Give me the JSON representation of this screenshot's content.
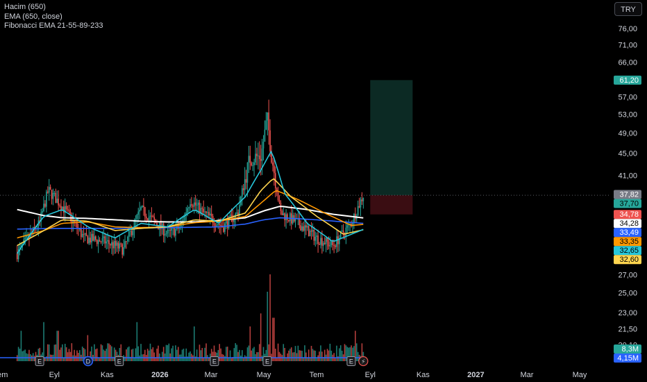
{
  "legend": {
    "volume_title": "Hacim (650)",
    "ema_title": "EMA (650, close)",
    "fib_title": "Fibonacci EMA 21-55-89-233"
  },
  "currency_button": "TRY",
  "colors": {
    "background": "#000000",
    "up": "#26a69a",
    "down": "#ef5350",
    "ema650": "#2962ff",
    "ema21": "#26c6da",
    "ema55": "#ffd54f",
    "ema89": "#ff9800",
    "ema233": "#ffffff",
    "target_zone": "#0c2a24",
    "stop_zone": "#3a0d12",
    "volume_line": "#2962ff"
  },
  "chart_data": {
    "type": "candlestick",
    "y_scale": "log",
    "ylim": [
      17.9,
      84.0
    ],
    "y_ticks": [
      "76,00",
      "71,00",
      "66,00",
      "57,00",
      "53,00",
      "49,00",
      "45,00",
      "41,00",
      "27,00",
      "25,00",
      "23,00",
      "21,50",
      "20,10"
    ],
    "x_ticks": [
      {
        "label": "Tem",
        "date": "2025-07"
      },
      {
        "label": "Eyl",
        "date": "2025-09"
      },
      {
        "label": "Kas",
        "date": "2025-11"
      },
      {
        "label": "2026",
        "date": "2026-01"
      },
      {
        "label": "Mar",
        "date": "2026-03"
      },
      {
        "label": "May",
        "date": "2026-05"
      },
      {
        "label": "Tem",
        "date": "2026-07"
      },
      {
        "label": "Eyl",
        "date": "2026-09"
      },
      {
        "label": "Kas",
        "date": "2026-11"
      },
      {
        "label": "2027",
        "date": "2027-01"
      },
      {
        "label": "Mar",
        "date": "2027-03"
      },
      {
        "label": "May",
        "date": "2027-05"
      }
    ],
    "last_close": 37.7,
    "price_path": [
      [
        "2025-07-20",
        29.5
      ],
      [
        "2025-08-15",
        33.5
      ],
      [
        "2025-08-25",
        38.5
      ],
      [
        "2025-09-10",
        36.0
      ],
      [
        "2025-10-05",
        31.5
      ],
      [
        "2025-10-30",
        31.0
      ],
      [
        "2025-11-20",
        30.0
      ],
      [
        "2025-12-10",
        35.5
      ],
      [
        "2026-01-10",
        32.0
      ],
      [
        "2026-01-25",
        33.0
      ],
      [
        "2026-02-05",
        37.0
      ],
      [
        "2026-02-20",
        35.0
      ],
      [
        "2026-03-15",
        33.0
      ],
      [
        "2026-04-01",
        35.0
      ],
      [
        "2026-04-15",
        44.0
      ],
      [
        "2026-04-28",
        44.5
      ],
      [
        "2026-05-05",
        52.0
      ],
      [
        "2026-05-10",
        44.5
      ],
      [
        "2026-05-20",
        35.0
      ],
      [
        "2026-06-10",
        33.5
      ],
      [
        "2026-07-01",
        31.5
      ],
      [
        "2026-07-20",
        30.5
      ],
      [
        "2026-08-10",
        33.5
      ],
      [
        "2026-08-24",
        37.7
      ]
    ],
    "ema_series": [
      {
        "name": "EMA 21",
        "color_key": "ema21",
        "last": 32.65,
        "points": [
          [
            "2025-07-20",
            29.5
          ],
          [
            "2025-08-20",
            34.5
          ],
          [
            "2025-09-10",
            35.5
          ],
          [
            "2025-10-10",
            33.0
          ],
          [
            "2025-11-10",
            31.5
          ],
          [
            "2025-12-10",
            33.5
          ],
          [
            "2026-01-10",
            33.0
          ],
          [
            "2026-02-10",
            35.5
          ],
          [
            "2026-03-10",
            33.5
          ],
          [
            "2026-04-10",
            37.5
          ],
          [
            "2026-04-28",
            42.0
          ],
          [
            "2026-05-10",
            45.5
          ],
          [
            "2026-05-25",
            38.0
          ],
          [
            "2026-06-20",
            33.5
          ],
          [
            "2026-07-20",
            31.0
          ],
          [
            "2026-08-24",
            32.65
          ]
        ]
      },
      {
        "name": "EMA 55",
        "color_key": "ema55",
        "last": 32.6,
        "points": [
          [
            "2025-07-20",
            30.5
          ],
          [
            "2025-08-20",
            32.5
          ],
          [
            "2025-09-10",
            34.0
          ],
          [
            "2025-10-10",
            33.8
          ],
          [
            "2025-11-10",
            32.5
          ],
          [
            "2025-12-10",
            32.8
          ],
          [
            "2026-01-10",
            33.0
          ],
          [
            "2026-02-10",
            34.0
          ],
          [
            "2026-03-10",
            33.8
          ],
          [
            "2026-04-10",
            35.0
          ],
          [
            "2026-04-28",
            38.5
          ],
          [
            "2026-05-12",
            40.5
          ],
          [
            "2026-06-01",
            37.5
          ],
          [
            "2026-07-01",
            34.5
          ],
          [
            "2026-08-01",
            32.0
          ],
          [
            "2026-08-24",
            32.6
          ]
        ]
      },
      {
        "name": "EMA 89",
        "color_key": "ema89",
        "last": 33.35,
        "points": [
          [
            "2025-07-20",
            31.5
          ],
          [
            "2025-08-20",
            32.5
          ],
          [
            "2025-09-10",
            33.5
          ],
          [
            "2025-10-10",
            33.7
          ],
          [
            "2025-11-10",
            33.0
          ],
          [
            "2025-12-10",
            32.9
          ],
          [
            "2026-01-10",
            33.0
          ],
          [
            "2026-02-10",
            33.6
          ],
          [
            "2026-03-10",
            33.8
          ],
          [
            "2026-04-10",
            34.5
          ],
          [
            "2026-04-28",
            36.5
          ],
          [
            "2026-05-15",
            38.5
          ],
          [
            "2026-06-10",
            37.0
          ],
          [
            "2026-07-10",
            35.0
          ],
          [
            "2026-08-10",
            33.2
          ],
          [
            "2026-08-24",
            33.35
          ]
        ]
      },
      {
        "name": "EMA 233",
        "color_key": "ema233",
        "last": 34.28,
        "points": [
          [
            "2025-07-20",
            35.5
          ],
          [
            "2025-08-20",
            34.6
          ],
          [
            "2025-09-10",
            34.3
          ],
          [
            "2025-10-10",
            34.2
          ],
          [
            "2025-11-10",
            34.0
          ],
          [
            "2025-12-10",
            33.8
          ],
          [
            "2026-01-10",
            33.7
          ],
          [
            "2026-02-10",
            33.7
          ],
          [
            "2026-03-10",
            33.9
          ],
          [
            "2026-04-10",
            34.3
          ],
          [
            "2026-05-01",
            35.3
          ],
          [
            "2026-05-20",
            36.0
          ],
          [
            "2026-06-20",
            35.5
          ],
          [
            "2026-07-20",
            34.8
          ],
          [
            "2026-08-24",
            34.28
          ]
        ]
      },
      {
        "name": "EMA 650",
        "color_key": "ema650",
        "last": 33.49,
        "points": [
          [
            "2025-07-20",
            32.7
          ],
          [
            "2025-09-10",
            32.8
          ],
          [
            "2025-11-10",
            32.8
          ],
          [
            "2026-01-10",
            32.9
          ],
          [
            "2026-03-10",
            33.0
          ],
          [
            "2026-04-10",
            33.4
          ],
          [
            "2026-05-01",
            34.0
          ],
          [
            "2026-05-20",
            34.3
          ],
          [
            "2026-07-01",
            34.0
          ],
          [
            "2026-08-24",
            33.49
          ]
        ]
      }
    ],
    "position_tool": {
      "start_date": "2026-09-01",
      "end_date": "2026-10-20",
      "entry": 37.7,
      "target": 61.2,
      "stop": 34.78
    },
    "price_labels": [
      {
        "text": "61,20",
        "value": 61.2,
        "bg": "#26a69a",
        "fg": "#ffffff"
      },
      {
        "text": "37,82",
        "value": 37.82,
        "bg": "#787b86",
        "fg": "#ffffff"
      },
      {
        "text": "37,70",
        "value": 37.7,
        "bg": "#26a69a",
        "fg": "#000000"
      },
      {
        "text": "34,78",
        "value": 34.78,
        "bg": "#ef5350",
        "fg": "#ffffff"
      },
      {
        "text": "34,28",
        "value": 34.28,
        "bg": "#ffffff",
        "fg": "#000000"
      },
      {
        "text": "33,49",
        "value": 33.49,
        "bg": "#2962ff",
        "fg": "#ffffff"
      },
      {
        "text": "33,35",
        "value": 33.35,
        "bg": "#ff9800",
        "fg": "#000000"
      },
      {
        "text": "32,65",
        "value": 32.65,
        "bg": "#26c6da",
        "fg": "#000000"
      },
      {
        "text": "32,60",
        "value": 32.6,
        "bg": "#ffd54f",
        "fg": "#000000"
      }
    ],
    "volume_labels": [
      {
        "text": "8,3M",
        "bg": "#26a69a",
        "fg": "#ffffff"
      },
      {
        "text": "4,15M",
        "bg": "#2962ff",
        "fg": "#ffffff"
      }
    ],
    "volume_spikes": [
      [
        "2025-07-25",
        0.35
      ],
      [
        "2025-08-20",
        0.45
      ],
      [
        "2025-09-05",
        0.35
      ],
      [
        "2025-10-10",
        0.3
      ],
      [
        "2025-12-05",
        0.45
      ],
      [
        "2026-02-10",
        0.4
      ],
      [
        "2026-04-15",
        0.4
      ],
      [
        "2026-04-28",
        0.55
      ],
      [
        "2026-05-05",
        0.8
      ],
      [
        "2026-05-08",
        1.0
      ],
      [
        "2026-05-12",
        0.5
      ],
      [
        "2026-08-15",
        0.35
      ]
    ],
    "event_markers": [
      {
        "date": "2025-08-15",
        "text": "E",
        "kind": "earnings"
      },
      {
        "date": "2025-10-10",
        "text": "D",
        "kind": "dividend"
      },
      {
        "date": "2025-11-15",
        "text": "E",
        "kind": "earnings"
      },
      {
        "date": "2026-03-05",
        "text": "E",
        "kind": "earnings"
      },
      {
        "date": "2026-05-05",
        "text": "E",
        "kind": "earnings"
      },
      {
        "date": "2026-08-10",
        "text": "E",
        "kind": "earnings"
      },
      {
        "date": "2026-08-24",
        "text": "⚡",
        "kind": "split"
      }
    ]
  }
}
